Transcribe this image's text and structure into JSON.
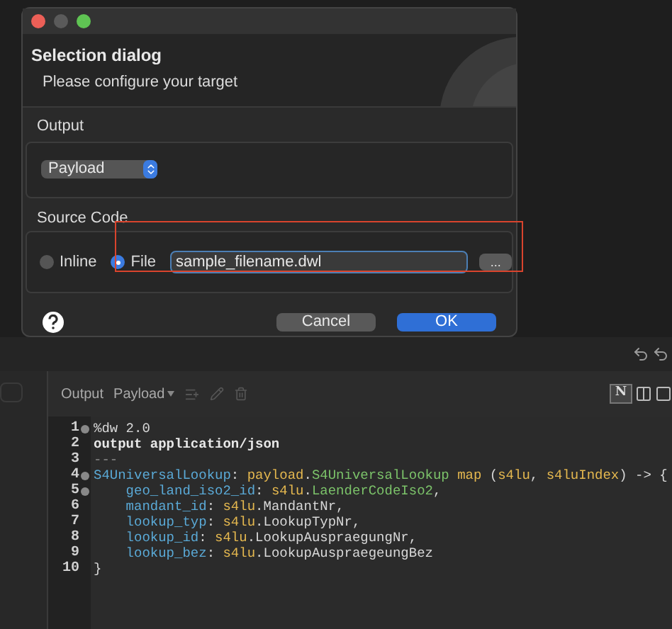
{
  "dialog": {
    "title": "Selection dialog",
    "subtitle": "Please configure your target",
    "output_label": "Output",
    "output_select": "Payload",
    "source_label": "Source Code",
    "radios": [
      {
        "label": "Inline",
        "selected": false
      },
      {
        "label": "File",
        "selected": true
      }
    ],
    "file_field": {
      "value": "sample_filename.dwl"
    },
    "browse_button": "...",
    "buttons": [
      {
        "label": "Cancel",
        "kind": "secondary"
      },
      {
        "label": "OK",
        "kind": "primary"
      }
    ]
  },
  "editor": {
    "toolbar": {
      "label": "Output",
      "selector": "Payload"
    },
    "view_button": "N",
    "lines": [
      {
        "number": "1",
        "fold": true,
        "tokens": [
          {
            "text": "%dw 2.0",
            "kind": "plain"
          }
        ]
      },
      {
        "number": "2",
        "fold": false,
        "tokens": [
          {
            "text": "output application/json",
            "kind": "keyword"
          }
        ]
      },
      {
        "number": "3",
        "fold": false,
        "tokens": [
          {
            "text": "---",
            "kind": "dim"
          }
        ]
      },
      {
        "number": "4",
        "fold": true,
        "tokens": [
          {
            "text": "S4UniversalLookup",
            "kind": "key"
          },
          {
            "text": ": ",
            "kind": "plain"
          },
          {
            "text": "payload",
            "kind": "var"
          },
          {
            "text": ".",
            "kind": "plain"
          },
          {
            "text": "S4UniversalLookup",
            "kind": "member"
          },
          {
            "text": " map ",
            "kind": "var"
          },
          {
            "text": "(",
            "kind": "plain"
          },
          {
            "text": "s4lu",
            "kind": "var"
          },
          {
            "text": ", ",
            "kind": "plain"
          },
          {
            "text": "s4luIndex",
            "kind": "var"
          },
          {
            "text": ") -> {",
            "kind": "plain"
          }
        ]
      },
      {
        "number": "5",
        "fold": true,
        "tokens": [
          {
            "text": "    geo_land_iso2_id",
            "kind": "key"
          },
          {
            "text": ": ",
            "kind": "plain"
          },
          {
            "text": "s4lu",
            "kind": "var"
          },
          {
            "text": ".",
            "kind": "plain"
          },
          {
            "text": "LaenderCodeIso2",
            "kind": "member"
          },
          {
            "text": ",",
            "kind": "plain"
          }
        ]
      },
      {
        "number": "6",
        "fold": false,
        "tokens": [
          {
            "text": "    mandant_id",
            "kind": "key"
          },
          {
            "text": ": ",
            "kind": "plain"
          },
          {
            "text": "s4lu",
            "kind": "var"
          },
          {
            "text": ".MandantNr,",
            "kind": "plain"
          }
        ]
      },
      {
        "number": "7",
        "fold": false,
        "tokens": [
          {
            "text": "    lookup_typ",
            "kind": "key"
          },
          {
            "text": ": ",
            "kind": "plain"
          },
          {
            "text": "s4lu",
            "kind": "var"
          },
          {
            "text": ".LookupTypNr,",
            "kind": "plain"
          }
        ]
      },
      {
        "number": "8",
        "fold": false,
        "tokens": [
          {
            "text": "    lookup_id",
            "kind": "key"
          },
          {
            "text": ": ",
            "kind": "plain"
          },
          {
            "text": "s4lu",
            "kind": "var"
          },
          {
            "text": ".LookupAuspraegungNr,",
            "kind": "plain"
          }
        ]
      },
      {
        "number": "9",
        "fold": false,
        "tokens": [
          {
            "text": "    lookup_bez",
            "kind": "key"
          },
          {
            "text": ": ",
            "kind": "plain"
          },
          {
            "text": "s4lu",
            "kind": "var"
          },
          {
            "text": ".LookupAuspraegeungBez",
            "kind": "plain"
          }
        ]
      },
      {
        "number": "10",
        "fold": false,
        "tokens": [
          {
            "text": "}",
            "kind": "plain"
          }
        ]
      }
    ]
  }
}
